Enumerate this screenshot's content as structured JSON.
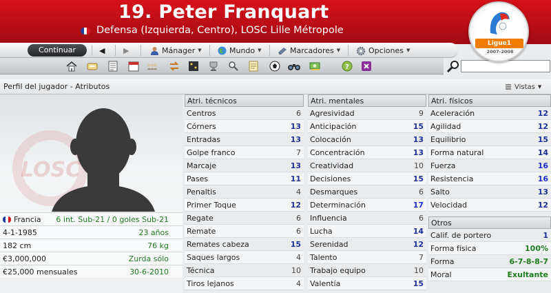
{
  "header": {
    "title": "19. Peter Franquart",
    "subtitle": "Defensa (Izquierda, Centro), LOSC Lille Métropole",
    "league_logo": {
      "brand": "Ligue1 Orange",
      "season": "2007-2008"
    },
    "colors": {
      "accent": "#c8101a",
      "logo_orange": "#f07d00"
    }
  },
  "nav": {
    "continue": "Continuar",
    "manager": "Mánager",
    "world": "Mundo",
    "bookmarks": "Marcadores",
    "options": "Opciones"
  },
  "toolbar": {
    "icons": [
      "home-icon",
      "inbox-icon",
      "news-icon",
      "calendar-icon",
      "squad-icon",
      "transfers-icon",
      "tactics-icon",
      "competitions-icon",
      "scout-icon",
      "notes-icon",
      "match-icon",
      "binoculars-icon",
      "finances-icon",
      "help-icon",
      "exit-icon"
    ]
  },
  "page": {
    "title": "Perfil del jugador - Atributos",
    "views": "Vistas"
  },
  "player": {
    "nationality": "Francia",
    "international": "6 int. Sub-21 / 0 goles Sub-21",
    "birthdate": "4-1-1985",
    "age": "23 años",
    "height": "182 cm",
    "weight": "76 kg",
    "value": "€3,000,000",
    "foot": "Zurda sólo",
    "wage": "€25,000 mensuales",
    "contract_end": "30-6-2010"
  },
  "technical": {
    "header": "Atri. técnicos",
    "rows": [
      {
        "name": "Centros",
        "value": "6"
      },
      {
        "name": "Córners",
        "value": "13"
      },
      {
        "name": "Entradas",
        "value": "13"
      },
      {
        "name": "Golpe franco",
        "value": "7"
      },
      {
        "name": "Marcaje",
        "value": "13"
      },
      {
        "name": "Pases",
        "value": "11"
      },
      {
        "name": "Penaltis",
        "value": "4"
      },
      {
        "name": "Primer Toque",
        "value": "12"
      },
      {
        "name": "Regate",
        "value": "6"
      },
      {
        "name": "Remate",
        "value": "6"
      },
      {
        "name": "Remates cabeza",
        "value": "15"
      },
      {
        "name": "Saques largos",
        "value": "4"
      },
      {
        "name": "Técnica",
        "value": "10"
      },
      {
        "name": "Tiros lejanos",
        "value": "4"
      }
    ]
  },
  "mental": {
    "header": "Atri. mentales",
    "rows": [
      {
        "name": "Agresividad",
        "value": "9"
      },
      {
        "name": "Anticipación",
        "value": "15"
      },
      {
        "name": "Colocación",
        "value": "13"
      },
      {
        "name": "Concentración",
        "value": "13"
      },
      {
        "name": "Creatividad",
        "value": "10"
      },
      {
        "name": "Decisiones",
        "value": "15"
      },
      {
        "name": "Desmarques",
        "value": "6"
      },
      {
        "name": "Determinación",
        "value": "17"
      },
      {
        "name": "Influencia",
        "value": "6"
      },
      {
        "name": "Lucha",
        "value": "14"
      },
      {
        "name": "Serenidad",
        "value": "12"
      },
      {
        "name": "Talento",
        "value": "7"
      },
      {
        "name": "Trabajo equipo",
        "value": "10"
      },
      {
        "name": "Valentía",
        "value": "15"
      }
    ]
  },
  "physical": {
    "header": "Atri. físicos",
    "rows": [
      {
        "name": "Aceleración",
        "value": "12"
      },
      {
        "name": "Agilidad",
        "value": "12"
      },
      {
        "name": "Equilibrio",
        "value": "15"
      },
      {
        "name": "Forma natural",
        "value": "14"
      },
      {
        "name": "Fuerza",
        "value": "16"
      },
      {
        "name": "Resistencia",
        "value": "16"
      },
      {
        "name": "Salto",
        "value": "13"
      },
      {
        "name": "Velocidad",
        "value": "12"
      }
    ]
  },
  "others": {
    "header": "Otros",
    "rows": [
      {
        "name": "Calif. de portero",
        "value": "1"
      },
      {
        "name": "Forma física",
        "value": "100%"
      },
      {
        "name": "Forma",
        "value": "6-7-8-8-7"
      },
      {
        "name": "Moral",
        "value": "Exultante"
      }
    ]
  }
}
